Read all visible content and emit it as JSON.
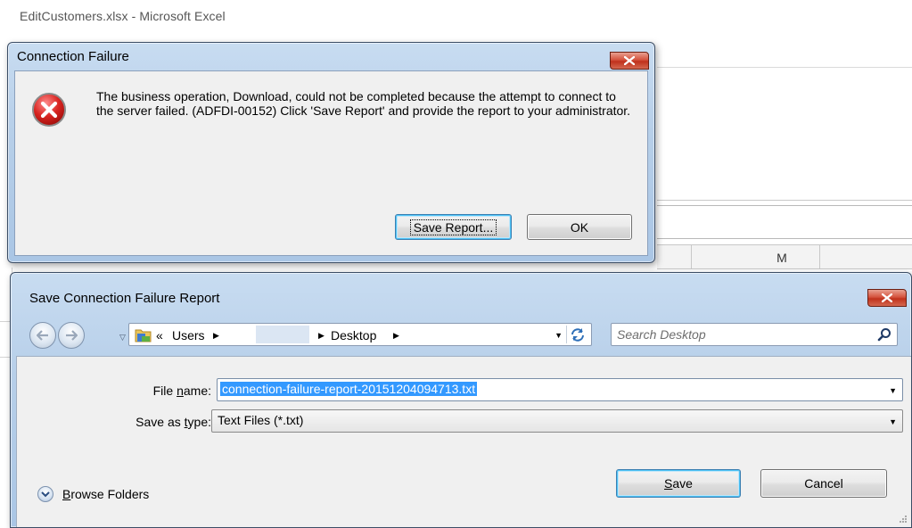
{
  "excel": {
    "window_title": "EditCustomers.xlsx  -  Microsoft Excel",
    "column_header": "M"
  },
  "connection_dialog": {
    "title": "Connection Failure",
    "message": "The business operation, Download, could not be completed because the attempt to connect to the server failed. (ADFDI-00152) Click 'Save Report' and provide the report to your administrator.",
    "save_report_label": "Save Report...",
    "ok_label": "OK",
    "icon": "error-icon"
  },
  "save_dialog": {
    "title": "Save Connection Failure Report",
    "breadcrumb": {
      "prefix": "«",
      "items": [
        "Users",
        "",
        "Desktop"
      ]
    },
    "search": {
      "placeholder": "Search Desktop"
    },
    "file_name": {
      "label_prefix": "File ",
      "label_accel": "n",
      "label_suffix": "ame:",
      "value": "connection-failure-report-20151204094713.txt"
    },
    "save_type": {
      "label_prefix": "Save as ",
      "label_accel": "t",
      "label_suffix": "ype:",
      "value": "Text Files (*.txt)"
    },
    "browse_folders": {
      "accel": "B",
      "rest": "rowse Folders"
    },
    "save_button": {
      "accel": "S",
      "rest": "ave"
    },
    "cancel_label": "Cancel"
  }
}
